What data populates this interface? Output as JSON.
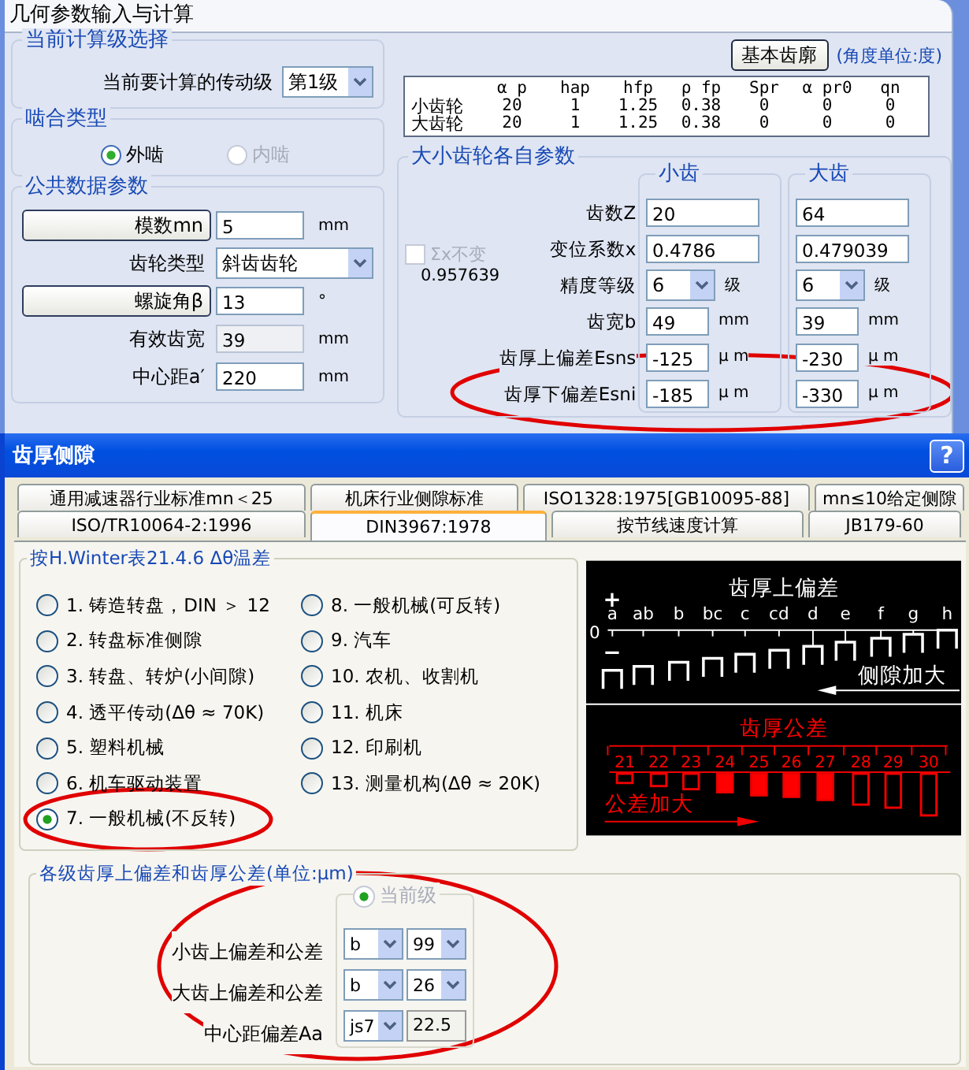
{
  "main_window": {
    "title": "几何参数输入与计算",
    "stage_group": {
      "title": "当前计算级选择",
      "label": "当前要计算的传动级",
      "value": "第1级"
    },
    "mesh_group": {
      "title": "啮合类型",
      "options": [
        {
          "label": "外啮",
          "selected": true,
          "disabled": false
        },
        {
          "label": "内啮",
          "selected": false,
          "disabled": true
        }
      ]
    },
    "common_group": {
      "title": "公共数据参数",
      "rows": [
        {
          "kind": "button",
          "label": "模数mn",
          "value": "5",
          "unit": "mm"
        },
        {
          "kind": "select",
          "label": "齿轮类型",
          "value": "斜齿齿轮"
        },
        {
          "kind": "button",
          "label": "螺旋角β",
          "value": "13",
          "unit": "°"
        },
        {
          "kind": "readonly",
          "label": "有效齿宽",
          "value": "39",
          "unit": "mm"
        },
        {
          "kind": "input",
          "label": "中心距a′",
          "value": "220",
          "unit": "mm"
        }
      ]
    },
    "profile_button": "基本齿廓",
    "angle_unit": "(角度单位:度)",
    "profile_table": {
      "columns": [
        "α p",
        "hap",
        "hfp",
        "ρ fp",
        "Spr",
        "α pr0",
        "qn"
      ],
      "rows": [
        {
          "name": "小齿轮",
          "cells": [
            "20",
            "1",
            "1.25",
            "0.38",
            "0",
            "0",
            "0"
          ]
        },
        {
          "name": "大齿轮",
          "cells": [
            "20",
            "1",
            "1.25",
            "0.38",
            "0",
            "0",
            "0"
          ]
        }
      ]
    },
    "gear_group": {
      "title": "大小齿轮各自参数",
      "column_titles": [
        "小齿",
        "大齿"
      ],
      "sum_checkbox": {
        "label": "Σx不变",
        "checked": false,
        "disabled": true
      },
      "sum_value": "0.957639",
      "rows": [
        {
          "kind": "input",
          "label": "齿数Z",
          "values": [
            "20",
            "64"
          ]
        },
        {
          "kind": "input",
          "label": "变位系数x",
          "values": [
            "0.4786",
            "0.479039"
          ]
        },
        {
          "kind": "select",
          "label": "精度等级",
          "values": [
            "6",
            "6"
          ],
          "units": [
            "级",
            "级"
          ]
        },
        {
          "kind": "input",
          "label": "齿宽b",
          "values": [
            "49",
            "39"
          ],
          "units": [
            "mm",
            "mm"
          ]
        },
        {
          "kind": "input",
          "label": "齿厚上偏差Esns",
          "values": [
            "-125",
            "-230"
          ],
          "units": [
            "μ m",
            "μ m"
          ]
        },
        {
          "kind": "input",
          "label": "齿厚下偏差Esni",
          "values": [
            "-185",
            "-330"
          ],
          "units": [
            "μ m",
            "μ m"
          ]
        }
      ]
    }
  },
  "dialog": {
    "title": "齿厚侧隙",
    "help": "?",
    "tab_rows": [
      [
        {
          "label": "通用减速器行业标准mn＜25",
          "selected": false
        },
        {
          "label": "机床行业侧隙标准",
          "selected": false
        },
        {
          "label": "ISO1328:1975[GB10095-88]",
          "selected": false
        },
        {
          "label": "mn≤10给定侧隙",
          "selected": false
        }
      ],
      [
        {
          "label": "ISO/TR10064-2:1996",
          "selected": false
        },
        {
          "label": "DIN3967:1978",
          "selected": true
        },
        {
          "label": "按节线速度计算",
          "selected": false
        },
        {
          "label": "JB179-60",
          "selected": false
        }
      ]
    ],
    "winter_group": {
      "title": "按H.Winter表21.4.6 Δθ温差",
      "options": [
        {
          "label": "1. 铸造转盘，DIN ＞ 12",
          "selected": false
        },
        {
          "label": "2. 转盘标准侧隙",
          "selected": false
        },
        {
          "label": "3. 转盘、转炉(小间隙)",
          "selected": false
        },
        {
          "label": "4. 透平传动(Δθ ≈ 70K)",
          "selected": false
        },
        {
          "label": "5. 塑料机械",
          "selected": false
        },
        {
          "label": "6. 机车驱动装置",
          "selected": false
        },
        {
          "label": "7. 一般机械(不反转)",
          "selected": true
        },
        {
          "label": "8. 一般机械(可反转)",
          "selected": false
        },
        {
          "label": "9. 汽车",
          "selected": false
        },
        {
          "label": "10. 农机、收割机",
          "selected": false
        },
        {
          "label": "11. 机床",
          "selected": false
        },
        {
          "label": "12. 印刷机",
          "selected": false
        },
        {
          "label": "13. 测量机构(Δθ ≈ 20K)",
          "selected": false
        }
      ]
    },
    "diagram": {
      "upper_title": "齿厚上偏差",
      "plus": "+",
      "minus": "−",
      "zero": "0",
      "deviation_letters": [
        "a",
        "ab",
        "b",
        "bc",
        "c",
        "cd",
        "d",
        "e",
        "f",
        "g",
        "h"
      ],
      "upper_arrow_label": "侧隙加大",
      "lower_title": "齿厚公差",
      "tolerance_grades": [
        {
          "label": "21",
          "filled": false
        },
        {
          "label": "22",
          "filled": false
        },
        {
          "label": "23",
          "filled": false
        },
        {
          "label": "24",
          "filled": true
        },
        {
          "label": "25",
          "filled": true
        },
        {
          "label": "26",
          "filled": true
        },
        {
          "label": "27",
          "filled": true
        },
        {
          "label": "28",
          "filled": false
        },
        {
          "label": "29",
          "filled": false
        },
        {
          "label": "30",
          "filled": false
        }
      ],
      "lower_arrow_label": "公差加大"
    },
    "tolerance_group": {
      "title": "各级齿厚上偏差和齿厚公差(单位:μm)",
      "current_radio": {
        "label": "当前级",
        "selected": true,
        "disabled": true
      },
      "rows": [
        {
          "kind": "two-select",
          "label": "小齿上偏差和公差",
          "values": [
            "b",
            "99"
          ]
        },
        {
          "kind": "two-select",
          "label": "大齿上偏差和公差",
          "values": [
            "b",
            "26"
          ]
        },
        {
          "kind": "select-field",
          "label": "中心距偏差Aa",
          "values": [
            "js7",
            "22.5"
          ]
        }
      ]
    }
  }
}
